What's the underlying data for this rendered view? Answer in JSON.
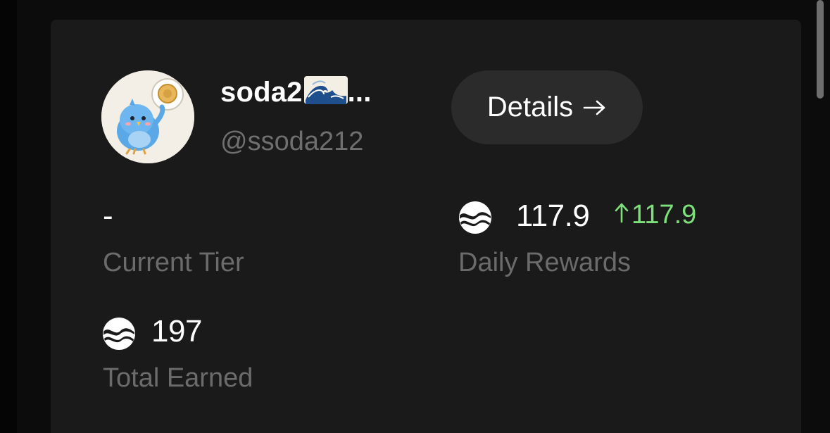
{
  "profile": {
    "display_name": "soda2",
    "name_truncation": "...",
    "handle": "@ssoda212"
  },
  "actions": {
    "details_label": "Details"
  },
  "stats": {
    "tier": {
      "value": "-",
      "label": "Current Tier"
    },
    "daily_rewards": {
      "value": "117.9",
      "delta": "117.9",
      "label": "Daily Rewards"
    },
    "total_earned": {
      "value": "197",
      "label": "Total Earned"
    }
  },
  "icons": {
    "token": "token-icon",
    "wave": "wave-emoji-icon",
    "arrow": "arrow-right-icon",
    "delta": "arrow-up-icon"
  },
  "colors": {
    "card_background": "#1a1a1a",
    "button_background": "#2b2b2b",
    "positive": "#7ee07a",
    "muted_text": "#6b6b6b"
  }
}
